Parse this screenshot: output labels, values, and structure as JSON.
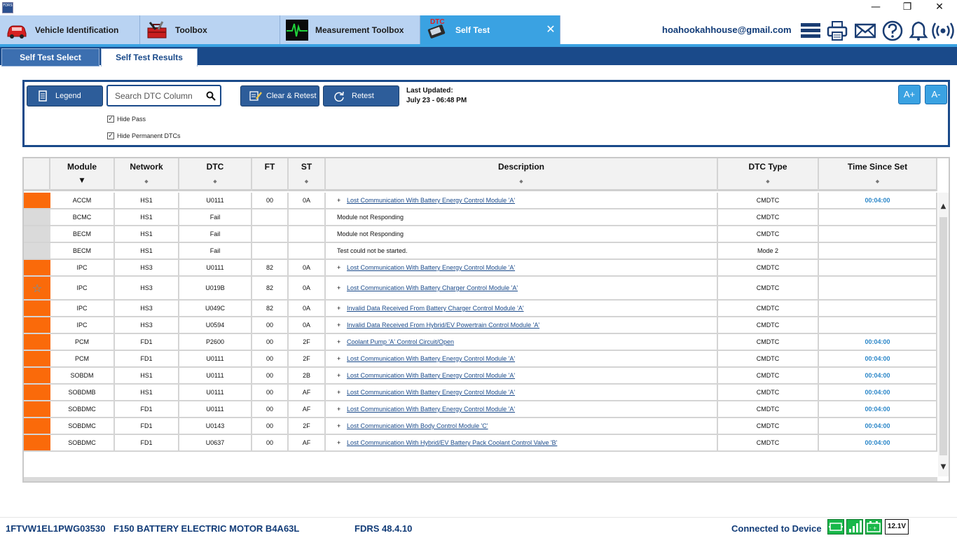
{
  "window": {
    "app_icon_label": "FDRS",
    "minimize": "—",
    "restore": "❐",
    "close": "✕"
  },
  "main_tabs": [
    {
      "label": "Vehicle Identification",
      "icon": "car-icon"
    },
    {
      "label": "Toolbox",
      "icon": "toolbox-icon"
    },
    {
      "label": "Measurement Toolbox",
      "icon": "oscilloscope-icon"
    },
    {
      "label": "Self Test",
      "icon": "dtc-tool-icon",
      "icon_text": "DTC",
      "close": "✕"
    }
  ],
  "header": {
    "user_email": "hoahookahhouse@gmail.com",
    "icons": [
      "menu-icon",
      "printer-icon",
      "mail-icon",
      "help-icon",
      "bell-icon",
      "wireless-icon"
    ]
  },
  "sub_tabs": [
    {
      "label": "Self Test Select"
    },
    {
      "label": "Self Test Results"
    }
  ],
  "toolbar": {
    "legend_label": "Legend",
    "search_placeholder": "Search DTC Column",
    "clear_retest_label": "Clear & Retest",
    "retest_label": "Retest",
    "last_updated_label": "Last Updated:",
    "last_updated_value": "July 23 - 06:48 PM",
    "font_increase": "A+",
    "font_decrease": "A-",
    "hide_pass_label": "Hide Pass",
    "hide_pass_checked": true,
    "hide_permanent_label": "Hide Permanent DTCs",
    "hide_permanent_checked": true
  },
  "table": {
    "columns": [
      "Module",
      "Network",
      "DTC",
      "FT",
      "ST",
      "Description",
      "DTC Type",
      "Time Since Set"
    ],
    "sort_indicator": "▼",
    "unsorted_indicator": "◆",
    "status_colors": {
      "fault": "#fa6a0a",
      "none": "#dadada"
    },
    "rows": [
      {
        "status": "fault",
        "star": false,
        "module": "ACCM",
        "network": "HS1",
        "dtc": "U0111",
        "ft": "00",
        "st": "0A",
        "plus": true,
        "description": "Lost Communication With Battery Energy Control Module 'A'",
        "link": true,
        "dtc_type": "CMDTC",
        "time": "00:04:00"
      },
      {
        "status": "none",
        "star": false,
        "module": "BCMC",
        "network": "HS1",
        "dtc": "Fail",
        "ft": "",
        "st": "",
        "plus": false,
        "description": "Module not Responding",
        "link": false,
        "dtc_type": "CMDTC",
        "time": ""
      },
      {
        "status": "none",
        "star": false,
        "module": "BECM",
        "network": "HS1",
        "dtc": "Fail",
        "ft": "",
        "st": "",
        "plus": false,
        "description": "Module not Responding",
        "link": false,
        "dtc_type": "CMDTC",
        "time": ""
      },
      {
        "status": "none",
        "star": false,
        "module": "BECM",
        "network": "HS1",
        "dtc": "Fail",
        "ft": "",
        "st": "",
        "plus": false,
        "description": "Test could not be started.",
        "link": false,
        "dtc_type": "Mode 2",
        "time": ""
      },
      {
        "status": "fault",
        "star": false,
        "module": "IPC",
        "network": "HS3",
        "dtc": "U0111",
        "ft": "82",
        "st": "0A",
        "plus": true,
        "description": "Lost Communication With Battery Energy Control Module 'A'",
        "link": true,
        "dtc_type": "CMDTC",
        "time": ""
      },
      {
        "status": "fault",
        "star": true,
        "module": "IPC",
        "network": "HS3",
        "dtc": "U019B",
        "ft": "82",
        "st": "0A",
        "plus": true,
        "description": "Lost Communication With Battery Charger Control Module 'A'",
        "link": true,
        "dtc_type": "CMDTC",
        "time": ""
      },
      {
        "status": "fault",
        "star": false,
        "module": "IPC",
        "network": "HS3",
        "dtc": "U049C",
        "ft": "82",
        "st": "0A",
        "plus": true,
        "description": "Invalid Data Received From Battery Charger Control Module 'A'",
        "link": true,
        "dtc_type": "CMDTC",
        "time": ""
      },
      {
        "status": "fault",
        "star": false,
        "module": "IPC",
        "network": "HS3",
        "dtc": "U0594",
        "ft": "00",
        "st": "0A",
        "plus": true,
        "description": "Invalid Data Received From Hybrid/EV Powertrain Control Module 'A'",
        "link": true,
        "dtc_type": "CMDTC",
        "time": ""
      },
      {
        "status": "fault",
        "star": false,
        "module": "PCM",
        "network": "FD1",
        "dtc": "P2600",
        "ft": "00",
        "st": "2F",
        "plus": true,
        "description": "Coolant Pump 'A' Control Circuit/Open",
        "link": true,
        "dtc_type": "CMDTC",
        "time": "00:04:00"
      },
      {
        "status": "fault",
        "star": false,
        "module": "PCM",
        "network": "FD1",
        "dtc": "U0111",
        "ft": "00",
        "st": "2F",
        "plus": true,
        "description": "Lost Communication With Battery Energy Control Module 'A'",
        "link": true,
        "dtc_type": "CMDTC",
        "time": "00:04:00"
      },
      {
        "status": "fault",
        "star": false,
        "module": "SOBDM",
        "network": "HS1",
        "dtc": "U0111",
        "ft": "00",
        "st": "2B",
        "plus": true,
        "description": "Lost Communication With Battery Energy Control Module 'A'",
        "link": true,
        "dtc_type": "CMDTC",
        "time": "00:04:00"
      },
      {
        "status": "fault",
        "star": false,
        "module": "SOBDMB",
        "network": "HS1",
        "dtc": "U0111",
        "ft": "00",
        "st": "AF",
        "plus": true,
        "description": "Lost Communication With Battery Energy Control Module 'A'",
        "link": true,
        "dtc_type": "CMDTC",
        "time": "00:04:00"
      },
      {
        "status": "fault",
        "star": false,
        "module": "SOBDMC",
        "network": "FD1",
        "dtc": "U0111",
        "ft": "00",
        "st": "AF",
        "plus": true,
        "description": "Lost Communication With Battery Energy Control Module 'A'",
        "link": true,
        "dtc_type": "CMDTC",
        "time": "00:04:00"
      },
      {
        "status": "fault",
        "star": false,
        "module": "SOBDMC",
        "network": "FD1",
        "dtc": "U0143",
        "ft": "00",
        "st": "2F",
        "plus": true,
        "description": "Lost Communication With Body Control Module 'C'",
        "link": true,
        "dtc_type": "CMDTC",
        "time": "00:04:00"
      },
      {
        "status": "fault",
        "star": false,
        "module": "SOBDMC",
        "network": "FD1",
        "dtc": "U0637",
        "ft": "00",
        "st": "AF",
        "plus": true,
        "description": "Lost Communication With Hybrid/EV Battery Pack Coolant Control Valve 'B'",
        "link": true,
        "dtc_type": "CMDTC",
        "time": "00:04:00"
      }
    ]
  },
  "status_bar": {
    "vin": "1FTVW1EL1PWG03530",
    "vehicle": "F150 BATTERY ELECTRIC MOTOR B4A63L",
    "version": "FDRS 48.4.10",
    "connection": "Connected to Device",
    "voltage": "12.1V"
  }
}
